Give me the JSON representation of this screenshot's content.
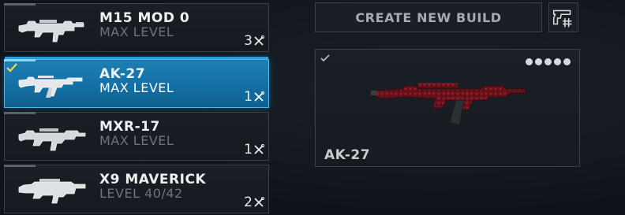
{
  "weapons": [
    {
      "name": "M15 MOD 0",
      "level": "MAX LEVEL",
      "count": "3",
      "selected": false
    },
    {
      "name": "AK-27",
      "level": "MAX LEVEL",
      "count": "1",
      "selected": true
    },
    {
      "name": "MXR-17",
      "level": "MAX LEVEL",
      "count": "1",
      "selected": false
    },
    {
      "name": "X9 MAVERICK",
      "level": "LEVEL 40/42",
      "count": "2",
      "selected": false
    }
  ],
  "actions": {
    "create_build_label": "CREATE NEW BUILD",
    "build_code_icon": "pistol-hash-icon"
  },
  "preview": {
    "weapon_name": "AK-27",
    "skin_color": "#7a1620",
    "dot_count": 5
  },
  "colors": {
    "accent": "#1d7fb3",
    "check": "#f0d84a"
  }
}
